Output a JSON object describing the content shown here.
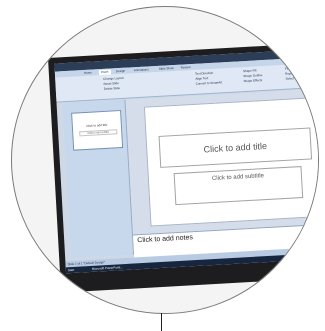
{
  "screen": {
    "tabs": [
      "Home",
      "Insert",
      "Design",
      "Animations",
      "Slide Show",
      "Review"
    ],
    "ribbon": {
      "left": [
        "Change Layout",
        "Reset Slide",
        "Delete Slide"
      ],
      "right": [
        "Text Direction",
        "Align Text",
        "Convert to SmartArt",
        "Shape Fill",
        "Shape Outline",
        "Shape Effects",
        "Find",
        "Replace",
        "Select"
      ]
    },
    "slide_panel": {
      "thumbnail_title": "Click to add title",
      "thumbnail_subtitle": "Click to add subtitle"
    },
    "slide": {
      "title_placeholder": "Click to add title",
      "subtitle_placeholder": "Click to add subtitle"
    },
    "notes": "Click to add notes",
    "status": "Slide 1 of 1 \"Default Design\"",
    "taskbar": {
      "start": "Start",
      "item": "Microsoft PowerPoint..."
    }
  }
}
